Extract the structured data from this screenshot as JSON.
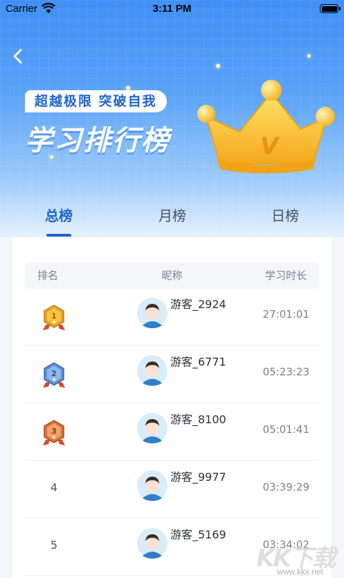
{
  "status_bar": {
    "carrier": "Carrier",
    "time": "3:11 PM"
  },
  "header": {
    "slogan": "超越极限  突破自我",
    "title": "学习排行榜",
    "crown_letter": "V"
  },
  "tabs": [
    {
      "label": "总榜",
      "active": true
    },
    {
      "label": "月榜",
      "active": false
    },
    {
      "label": "日榜",
      "active": false
    }
  ],
  "table": {
    "headers": {
      "rank": "排名",
      "name": "昵称",
      "time": "学习时长"
    },
    "rows": [
      {
        "rank": "1",
        "medal": "gold",
        "name": "游客_2924",
        "time": "27:01:01"
      },
      {
        "rank": "2",
        "medal": "silver",
        "name": "游客_6771",
        "time": "05:23:23"
      },
      {
        "rank": "3",
        "medal": "bronze",
        "name": "游客_8100",
        "time": "05:01:41"
      },
      {
        "rank": "4",
        "medal": null,
        "name": "游客_9977",
        "time": "03:39:29"
      },
      {
        "rank": "5",
        "medal": null,
        "name": "游客_5169",
        "time": "03:34:02"
      }
    ]
  },
  "watermark": {
    "brand": "KK下载",
    "url": "www.kkx.net"
  },
  "colors": {
    "accent": "#1e63d4",
    "gold": "#e8a321",
    "silver": "#5b8fd6",
    "bronze": "#d8713a"
  }
}
